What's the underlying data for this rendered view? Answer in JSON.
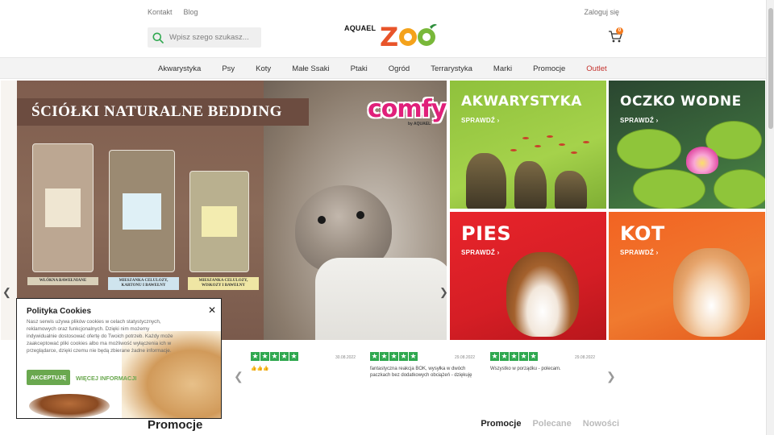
{
  "header": {
    "links": [
      "Kontakt",
      "Blog"
    ],
    "login": "Zaloguj się",
    "search_placeholder": "Wpisz szego szukasz...",
    "logo_brand": "AQUAEL",
    "logo_name": "ZOO",
    "cart_count": "0"
  },
  "nav": {
    "items": [
      "Akwarystyka",
      "Psy",
      "Koty",
      "Małe Ssaki",
      "Ptaki",
      "Ogród",
      "Terrarystyka",
      "Marki",
      "Promocje",
      "Outlet"
    ]
  },
  "hero": {
    "title": "ŚCIÓŁKI NATURALNE BEDDING",
    "badge": "comfy",
    "badge_sub": "by AQUAEL",
    "bag_captions": [
      "WŁÓKNA BAWEŁNIANE",
      "MIESZANKA CELULOZY, KARTONU I BAWEŁNY",
      "MIESZANKA CELULOZY, WISKOZY I BAWEŁNY"
    ]
  },
  "tiles": [
    {
      "title": "AKWARYSTYKA",
      "link": "SPRAWDŹ ›"
    },
    {
      "title": "OCZKO WODNE",
      "link": "SPRAWDŹ ›"
    },
    {
      "title": "PIES",
      "link": "SPRAWDŹ ›"
    },
    {
      "title": "KOT",
      "link": "SPRAWDŹ ›"
    }
  ],
  "reviews": [
    {
      "rating": 5,
      "date": "30.08.2022",
      "text": "👍👍👍"
    },
    {
      "rating": 5,
      "date": "29.08.2022",
      "text": "fantastyczna reakcja BOK, wysyłka w dwóch paczkach bez dodatkowych obciążeń - dziękuję"
    },
    {
      "rating": 5,
      "date": "29.08.2022",
      "text": "Wszystko w porządku - polecam."
    }
  ],
  "cookie": {
    "title": "Polityka Cookies",
    "text": "Nasz serwis używa plików cookies w celach statystycznych, reklamowych oraz funkcjonalnych. Dzięki nim możemy indywidualnie dostosować ofertę do Twoich potrzeb. Każdy może zaakceptować pliki cookies albo ma możliwość wyłączenia ich w przeglądarce, dzięki czemu nie będą zbierane żadne informacje.",
    "accept": "AKCEPTUJĘ",
    "more": "WIĘCEJ INFORMACJI"
  },
  "bottom": {
    "heading": "Promocje",
    "tabs": [
      "Promocje",
      "Polecane",
      "Nowości"
    ]
  },
  "colors": {
    "accent_green": "#6aa84f",
    "outlet_red": "#c4302b",
    "cart_badge": "#f47b20",
    "review_star": "#2fa84f"
  }
}
